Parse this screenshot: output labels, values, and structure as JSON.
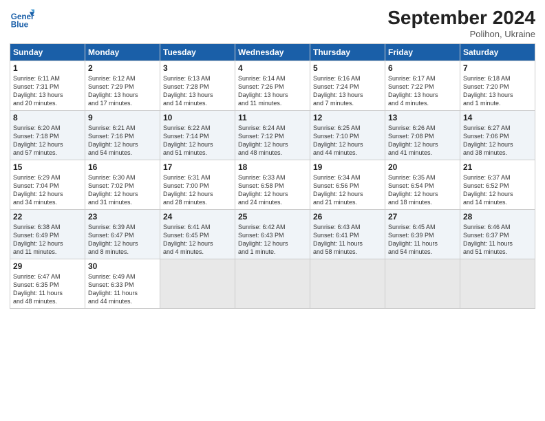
{
  "header": {
    "logo_text_general": "General",
    "logo_text_blue": "Blue",
    "month_title": "September 2024",
    "location": "Polihon, Ukraine"
  },
  "days_of_week": [
    "Sunday",
    "Monday",
    "Tuesday",
    "Wednesday",
    "Thursday",
    "Friday",
    "Saturday"
  ],
  "weeks": [
    [
      {
        "day": "1",
        "lines": [
          "Sunrise: 6:11 AM",
          "Sunset: 7:31 PM",
          "Daylight: 13 hours",
          "and 20 minutes."
        ]
      },
      {
        "day": "2",
        "lines": [
          "Sunrise: 6:12 AM",
          "Sunset: 7:29 PM",
          "Daylight: 13 hours",
          "and 17 minutes."
        ]
      },
      {
        "day": "3",
        "lines": [
          "Sunrise: 6:13 AM",
          "Sunset: 7:28 PM",
          "Daylight: 13 hours",
          "and 14 minutes."
        ]
      },
      {
        "day": "4",
        "lines": [
          "Sunrise: 6:14 AM",
          "Sunset: 7:26 PM",
          "Daylight: 13 hours",
          "and 11 minutes."
        ]
      },
      {
        "day": "5",
        "lines": [
          "Sunrise: 6:16 AM",
          "Sunset: 7:24 PM",
          "Daylight: 13 hours",
          "and 7 minutes."
        ]
      },
      {
        "day": "6",
        "lines": [
          "Sunrise: 6:17 AM",
          "Sunset: 7:22 PM",
          "Daylight: 13 hours",
          "and 4 minutes."
        ]
      },
      {
        "day": "7",
        "lines": [
          "Sunrise: 6:18 AM",
          "Sunset: 7:20 PM",
          "Daylight: 13 hours",
          "and 1 minute."
        ]
      }
    ],
    [
      {
        "day": "8",
        "lines": [
          "Sunrise: 6:20 AM",
          "Sunset: 7:18 PM",
          "Daylight: 12 hours",
          "and 57 minutes."
        ]
      },
      {
        "day": "9",
        "lines": [
          "Sunrise: 6:21 AM",
          "Sunset: 7:16 PM",
          "Daylight: 12 hours",
          "and 54 minutes."
        ]
      },
      {
        "day": "10",
        "lines": [
          "Sunrise: 6:22 AM",
          "Sunset: 7:14 PM",
          "Daylight: 12 hours",
          "and 51 minutes."
        ]
      },
      {
        "day": "11",
        "lines": [
          "Sunrise: 6:24 AM",
          "Sunset: 7:12 PM",
          "Daylight: 12 hours",
          "and 48 minutes."
        ]
      },
      {
        "day": "12",
        "lines": [
          "Sunrise: 6:25 AM",
          "Sunset: 7:10 PM",
          "Daylight: 12 hours",
          "and 44 minutes."
        ]
      },
      {
        "day": "13",
        "lines": [
          "Sunrise: 6:26 AM",
          "Sunset: 7:08 PM",
          "Daylight: 12 hours",
          "and 41 minutes."
        ]
      },
      {
        "day": "14",
        "lines": [
          "Sunrise: 6:27 AM",
          "Sunset: 7:06 PM",
          "Daylight: 12 hours",
          "and 38 minutes."
        ]
      }
    ],
    [
      {
        "day": "15",
        "lines": [
          "Sunrise: 6:29 AM",
          "Sunset: 7:04 PM",
          "Daylight: 12 hours",
          "and 34 minutes."
        ]
      },
      {
        "day": "16",
        "lines": [
          "Sunrise: 6:30 AM",
          "Sunset: 7:02 PM",
          "Daylight: 12 hours",
          "and 31 minutes."
        ]
      },
      {
        "day": "17",
        "lines": [
          "Sunrise: 6:31 AM",
          "Sunset: 7:00 PM",
          "Daylight: 12 hours",
          "and 28 minutes."
        ]
      },
      {
        "day": "18",
        "lines": [
          "Sunrise: 6:33 AM",
          "Sunset: 6:58 PM",
          "Daylight: 12 hours",
          "and 24 minutes."
        ]
      },
      {
        "day": "19",
        "lines": [
          "Sunrise: 6:34 AM",
          "Sunset: 6:56 PM",
          "Daylight: 12 hours",
          "and 21 minutes."
        ]
      },
      {
        "day": "20",
        "lines": [
          "Sunrise: 6:35 AM",
          "Sunset: 6:54 PM",
          "Daylight: 12 hours",
          "and 18 minutes."
        ]
      },
      {
        "day": "21",
        "lines": [
          "Sunrise: 6:37 AM",
          "Sunset: 6:52 PM",
          "Daylight: 12 hours",
          "and 14 minutes."
        ]
      }
    ],
    [
      {
        "day": "22",
        "lines": [
          "Sunrise: 6:38 AM",
          "Sunset: 6:49 PM",
          "Daylight: 12 hours",
          "and 11 minutes."
        ]
      },
      {
        "day": "23",
        "lines": [
          "Sunrise: 6:39 AM",
          "Sunset: 6:47 PM",
          "Daylight: 12 hours",
          "and 8 minutes."
        ]
      },
      {
        "day": "24",
        "lines": [
          "Sunrise: 6:41 AM",
          "Sunset: 6:45 PM",
          "Daylight: 12 hours",
          "and 4 minutes."
        ]
      },
      {
        "day": "25",
        "lines": [
          "Sunrise: 6:42 AM",
          "Sunset: 6:43 PM",
          "Daylight: 12 hours",
          "and 1 minute."
        ]
      },
      {
        "day": "26",
        "lines": [
          "Sunrise: 6:43 AM",
          "Sunset: 6:41 PM",
          "Daylight: 11 hours",
          "and 58 minutes."
        ]
      },
      {
        "day": "27",
        "lines": [
          "Sunrise: 6:45 AM",
          "Sunset: 6:39 PM",
          "Daylight: 11 hours",
          "and 54 minutes."
        ]
      },
      {
        "day": "28",
        "lines": [
          "Sunrise: 6:46 AM",
          "Sunset: 6:37 PM",
          "Daylight: 11 hours",
          "and 51 minutes."
        ]
      }
    ],
    [
      {
        "day": "29",
        "lines": [
          "Sunrise: 6:47 AM",
          "Sunset: 6:35 PM",
          "Daylight: 11 hours",
          "and 48 minutes."
        ]
      },
      {
        "day": "30",
        "lines": [
          "Sunrise: 6:49 AM",
          "Sunset: 6:33 PM",
          "Daylight: 11 hours",
          "and 44 minutes."
        ]
      },
      {
        "day": "",
        "lines": []
      },
      {
        "day": "",
        "lines": []
      },
      {
        "day": "",
        "lines": []
      },
      {
        "day": "",
        "lines": []
      },
      {
        "day": "",
        "lines": []
      }
    ]
  ]
}
